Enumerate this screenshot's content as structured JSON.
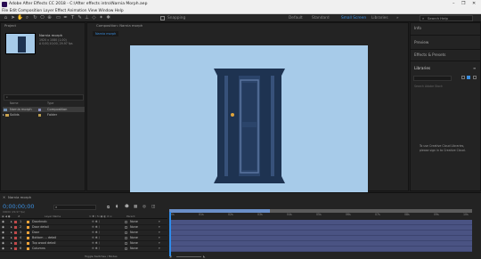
{
  "window": {
    "title": "Adobe After Effects CC 2018 - C:\\After effects intro\\Narnia Morph.aep",
    "controls": [
      "–",
      "❐",
      "✕"
    ]
  },
  "menu": [
    "File",
    "Edit",
    "Composition",
    "Layer",
    "Effect",
    "Animation",
    "View",
    "Window",
    "Help"
  ],
  "toolbar": {
    "snapping_label": "Snapping",
    "workspaces": [
      "Default",
      "Standard",
      "Small Screen",
      "Libraries"
    ],
    "active_workspace": "Small Screen",
    "search_placeholder": "Search Help"
  },
  "project": {
    "tab": "Project",
    "comp_name": "Narnia morph",
    "comp_info1": "1920 x 1080 (1.00)",
    "comp_info2": "Δ 0;00;10;00, 29.97 fps",
    "col_name": "Name",
    "col_type": "Type",
    "items": [
      {
        "name": "Narnia morph",
        "type": "Composition"
      },
      {
        "name": "Solids",
        "type": "Folder"
      }
    ],
    "bit_depth": "8 bpc"
  },
  "composition": {
    "tab": "Composition: Narnia morph",
    "crumb": "Narnia morph",
    "zoom": "(100%)",
    "time": "0;00;00;00",
    "resolution": "(Full)",
    "camera": "Active Camera",
    "views": "1 View",
    "exposure": "+0.0",
    "bg_color": "#a7cbe9",
    "door_color": "#1e3351"
  },
  "right_panels": {
    "items": [
      "Info",
      "Preview",
      "Effects & Presets",
      "Libraries"
    ],
    "libraries_search": "Search Adobe Stock",
    "libraries_msg1": "To use Creative Cloud Libraries,",
    "libraries_msg2": "please sign in to Creative Cloud."
  },
  "timeline": {
    "tab": "Narnia morph",
    "time": "0;00;00;00",
    "frames": "00000 (29.97 fps)",
    "search_placeholder": "",
    "col_layer_name": "Layer Name",
    "col_parent": "Parent",
    "ruler": [
      "00s",
      "01s",
      "02s",
      "03s",
      "04s",
      "05s",
      "06s",
      "07s",
      "08s",
      "09s",
      "10s"
    ],
    "layers": [
      {
        "num": "1",
        "name": "Doorknob",
        "color": "#c14a4a",
        "parent": "None"
      },
      {
        "num": "2",
        "name": "Door detail",
        "color": "#c14a4a",
        "parent": "None"
      },
      {
        "num": "3",
        "name": "Door",
        "color": "#c14a4a",
        "parent": "None"
      },
      {
        "num": "4",
        "name": "Bottom ... detail",
        "color": "#c14a4a",
        "parent": "None"
      },
      {
        "num": "5",
        "name": "Top wood detail",
        "color": "#c14a4a",
        "parent": "None"
      },
      {
        "num": "6",
        "name": "Columns",
        "color": "#c14a4a",
        "parent": "None"
      }
    ],
    "footer": "Toggle Switches / Modes",
    "track_color": "#4a5383",
    "accent": "#2d8ceb"
  }
}
